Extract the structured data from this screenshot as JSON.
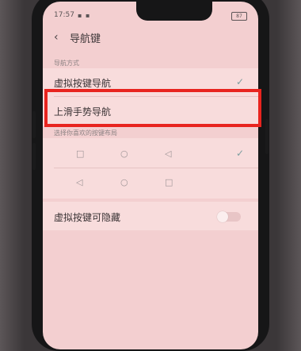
{
  "status": {
    "time": "17:57",
    "battery": "87"
  },
  "header": {
    "title": "导航键"
  },
  "nav_section": {
    "label": "导航方式",
    "options": [
      {
        "label": "虚拟按键导航",
        "selected": true
      },
      {
        "label": "上滑手势导航",
        "selected": false
      }
    ]
  },
  "layout_section": {
    "label": "选择你喜欢的按键布局",
    "layouts": [
      {
        "icons": [
          "square",
          "circle",
          "triangle-left"
        ],
        "selected": true
      },
      {
        "icons": [
          "triangle-left",
          "circle",
          "square"
        ],
        "selected": false
      }
    ]
  },
  "hide_option": {
    "label": "虚拟按键可隐藏",
    "enabled": false
  },
  "colors": {
    "screen": "#f3cfd0",
    "highlight": "#e8241f"
  }
}
